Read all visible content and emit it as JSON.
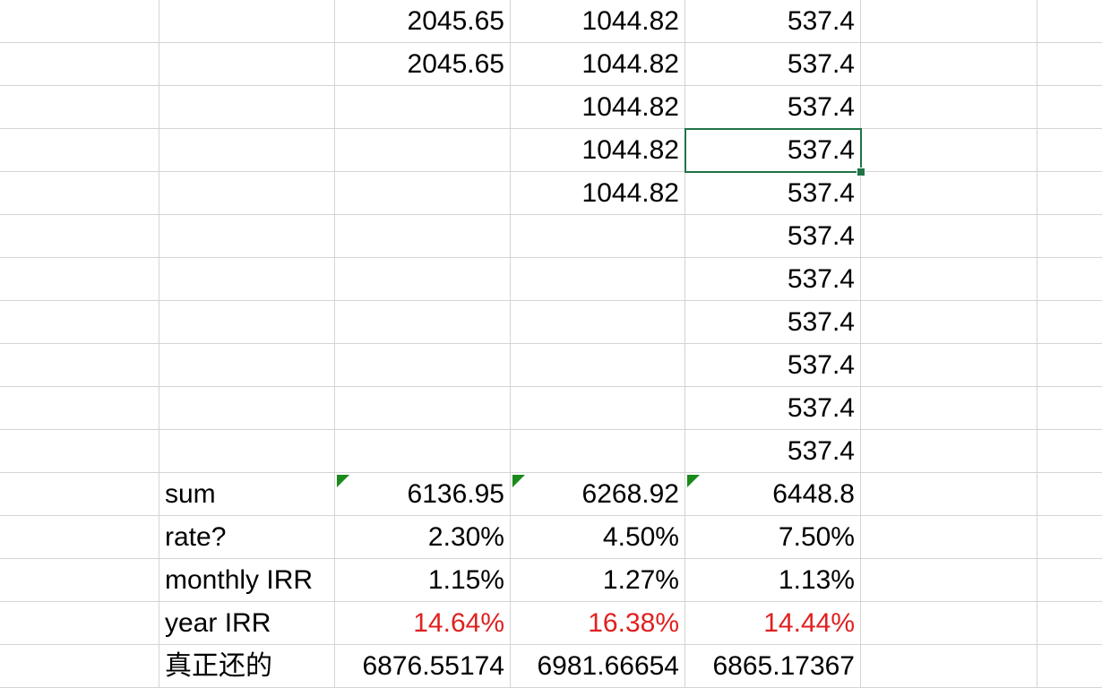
{
  "sheet": {
    "rows": [
      {
        "b": "",
        "c": "2045.65",
        "d": "1044.82",
        "e": "537.4"
      },
      {
        "b": "",
        "c": "2045.65",
        "d": "1044.82",
        "e": "537.4"
      },
      {
        "b": "",
        "c": "",
        "d": "1044.82",
        "e": "537.4"
      },
      {
        "b": "",
        "c": "",
        "d": "1044.82",
        "e": "537.4"
      },
      {
        "b": "",
        "c": "",
        "d": "1044.82",
        "e": "537.4"
      },
      {
        "b": "",
        "c": "",
        "d": "",
        "e": "537.4"
      },
      {
        "b": "",
        "c": "",
        "d": "",
        "e": "537.4"
      },
      {
        "b": "",
        "c": "",
        "d": "",
        "e": "537.4"
      },
      {
        "b": "",
        "c": "",
        "d": "",
        "e": "537.4"
      },
      {
        "b": "",
        "c": "",
        "d": "",
        "e": "537.4"
      },
      {
        "b": "",
        "c": "",
        "d": "",
        "e": "537.4"
      },
      {
        "b": "sum",
        "c": "6136.95",
        "d": "6268.92",
        "e": "6448.8",
        "flags": true
      },
      {
        "b": "rate?",
        "c": "2.30%",
        "d": "4.50%",
        "e": "7.50%"
      },
      {
        "b": "monthly IRR",
        "c": "1.15%",
        "d": "1.27%",
        "e": "1.13%"
      },
      {
        "b": "year IRR",
        "c": "14.64%",
        "d": "16.38%",
        "e": "14.44%",
        "highlight": true
      },
      {
        "b": "真正还的",
        "c": "6876.55174",
        "d": "6981.66654",
        "e": "6865.17367",
        "cjk": true
      }
    ],
    "selected_cell": {
      "row": 3,
      "col": "e"
    },
    "colors": {
      "grid": "#d4d4d4",
      "highlight": "#e02020",
      "selection": "#217346",
      "flag": "#1a8a1a"
    }
  }
}
